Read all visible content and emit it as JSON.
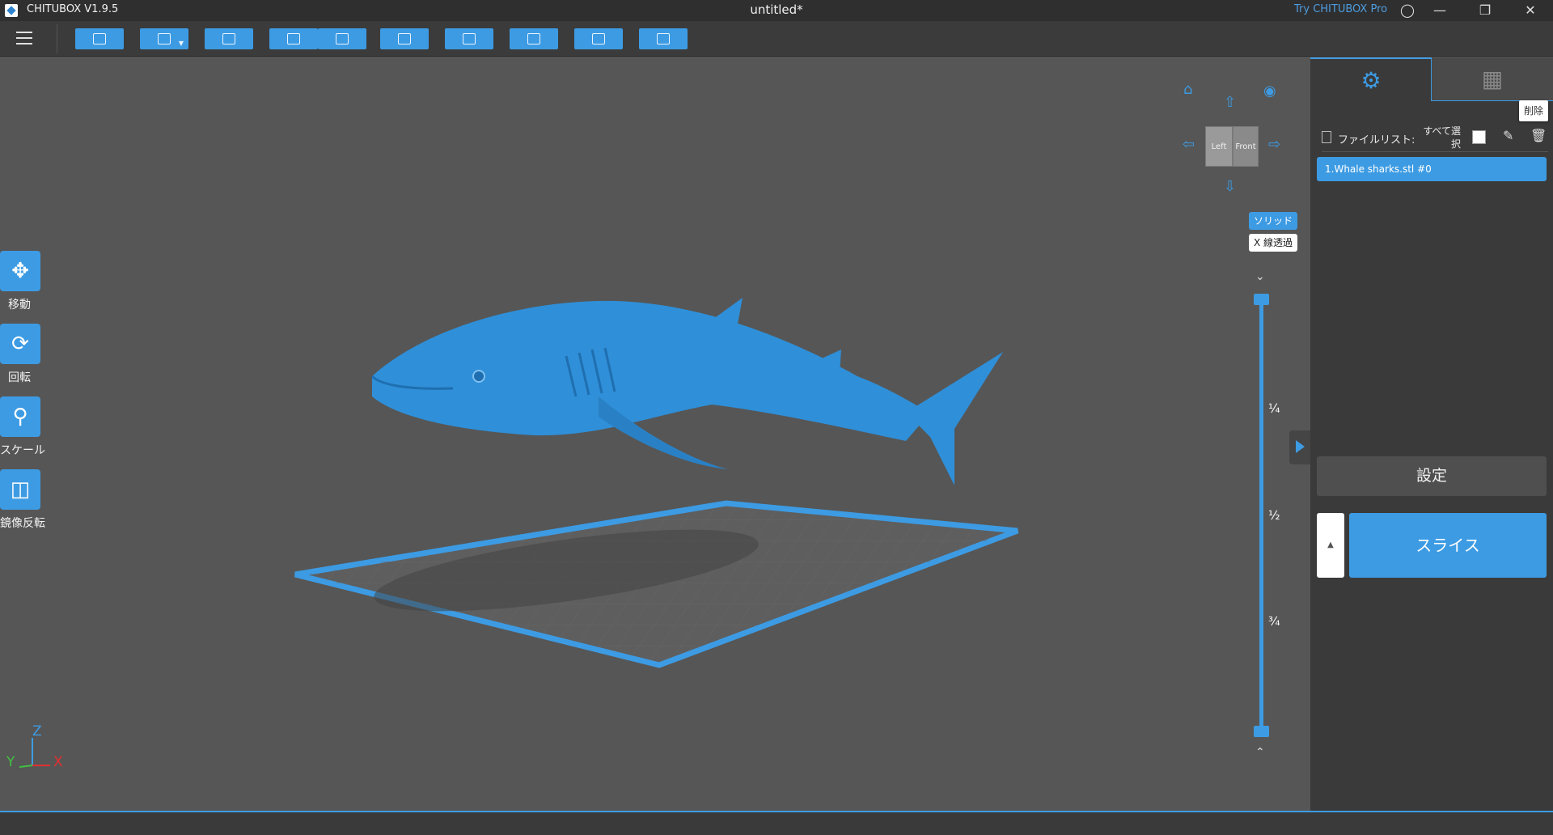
{
  "window": {
    "app_name": "CHITUBOX V1.9.5",
    "doc_title": "untitled*",
    "try_pro": "Try CHITUBOX Pro"
  },
  "toolbar": {
    "buttons": [
      "open-file",
      "save",
      "center",
      "undo",
      "redo",
      "list",
      "auto-layout",
      "hollow",
      "drill",
      "export"
    ]
  },
  "left_tools": [
    {
      "label": "移動",
      "icon": "move-icon"
    },
    {
      "label": "回転",
      "icon": "rotate-icon"
    },
    {
      "label": "スケール",
      "icon": "scale-icon"
    },
    {
      "label": "鏡像反転",
      "icon": "mirror-icon"
    }
  ],
  "view": {
    "cube_left": "Left",
    "cube_front": "Front",
    "mode_solid": "ソリッド",
    "mode_xray": "X 線透過"
  },
  "slider": {
    "quarter": "¼",
    "half": "½",
    "three_quarter": "¾"
  },
  "axis": {
    "z": "Z",
    "y": "Y",
    "x": "X"
  },
  "right_panel": {
    "tooltip": "削除",
    "file_list_label": "ファイルリスト:",
    "select_all": "すべて選択",
    "files": [
      "1.Whale sharks.stl #0"
    ],
    "settings_button": "設定",
    "slice_button": "スライス"
  },
  "colors": {
    "accent": "#3d9be3",
    "viewport": "#565656",
    "panel": "#3a3a3a"
  }
}
